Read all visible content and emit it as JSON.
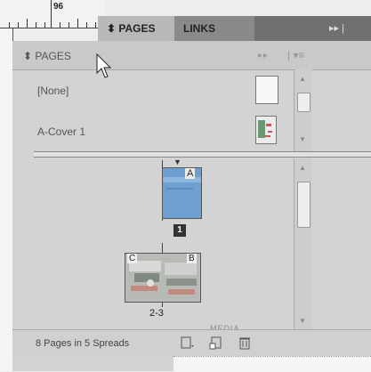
{
  "ruler": {
    "label": "96"
  },
  "dock": {
    "tabs": [
      {
        "label": "⬍ PAGES"
      },
      {
        "label": "LINKS"
      }
    ],
    "arrows": "▸▸ |"
  },
  "panel": {
    "title": "⬍ PAGES",
    "arrows": "▸▸",
    "menu": "| ▾≡",
    "masters": [
      {
        "label": "[None]"
      },
      {
        "label": "A-Cover 1"
      }
    ],
    "pages": [
      {
        "master_letter": "A",
        "number": "1"
      },
      {
        "left_letter": "C",
        "right_letter": "B",
        "label": "2-3"
      }
    ],
    "footer_text": "8 Pages in 5 Spreads",
    "behind_label": "MEDIA"
  },
  "icons": {
    "footer": [
      "page-size-icon",
      "new-page-icon",
      "delete-page-icon"
    ],
    "cursor": "arrow-cursor-icon"
  },
  "colors": {
    "page_thumb": "#6d9fd1",
    "panel_bg": "#d3d3d3"
  }
}
